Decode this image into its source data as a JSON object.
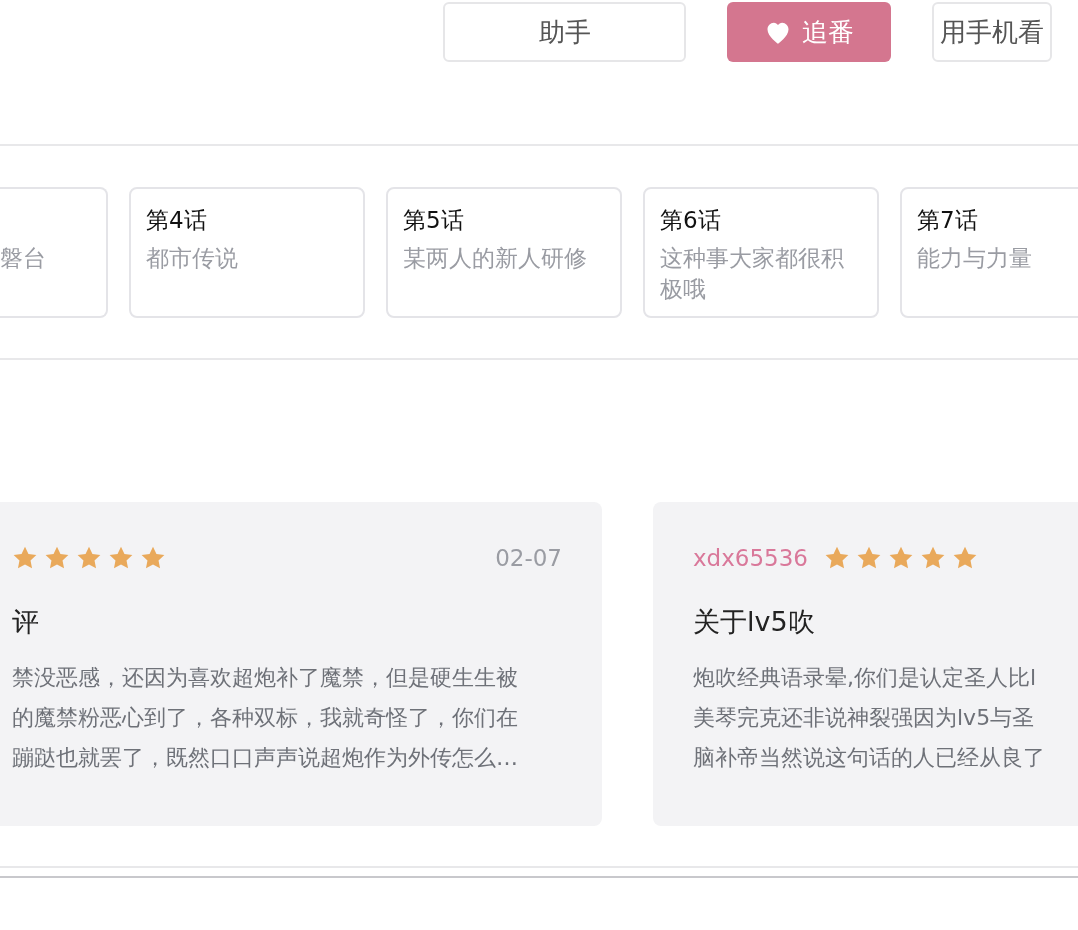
{
  "actions": [
    {
      "label": "助手",
      "kind": "plain"
    },
    {
      "label": "追番",
      "kind": "primary"
    },
    {
      "label": "用手机看",
      "kind": "plain"
    }
  ],
  "episodes": [
    {
      "subtitle": "磐台"
    },
    {
      "title": "第4话",
      "subtitle": "都市传说"
    },
    {
      "title": "第5话",
      "subtitle": "某两人的新人研修"
    },
    {
      "title": "第6话",
      "subtitle": "这种事大家都很积极哦"
    },
    {
      "title": "第7话",
      "subtitle": "能力与力量"
    }
  ],
  "reviews": [
    {
      "stars": 5,
      "date": "02-07",
      "title": "评",
      "body": [
        "禁没恶感，还因为喜欢超炮补了魔禁，但是硬生生被",
        "的魔禁粉恶心到了，各种双标，我就奇怪了，你们在",
        "蹦跶也就罢了，既然口口声声说超炮作为外传怎么…"
      ]
    },
    {
      "user": "xdx65536",
      "stars": 5,
      "title": "关于lv5吹",
      "body": [
        "炮吹经典语录晕,你们是认定圣人比l",
        "美琴完克还非说神裂强因为lv5与圣",
        "脑补帝当然说这句话的人已经从良了"
      ]
    }
  ]
}
